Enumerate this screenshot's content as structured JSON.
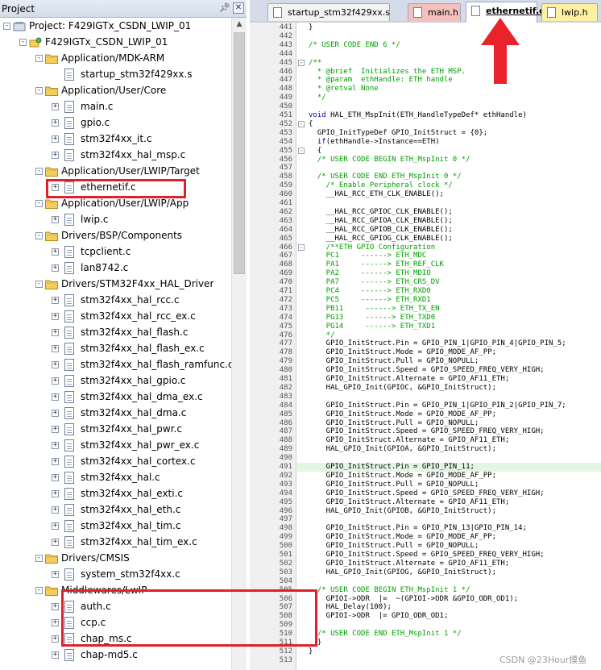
{
  "project_panel": {
    "title": "Project",
    "pin_icon": "pin-icon",
    "close_icon": "close-icon",
    "tree": [
      {
        "label": "Project: F429IGTx_CSDN_LWIP_01",
        "type": "project",
        "toggle": "-"
      },
      {
        "label": "F429IGTx_CSDN_LWIP_01",
        "type": "target",
        "toggle": "-"
      },
      {
        "label": "Application/MDK-ARM",
        "type": "folder",
        "toggle": "-"
      },
      {
        "label": "startup_stm32f429xx.s",
        "type": "file",
        "toggle": ""
      },
      {
        "label": "Application/User/Core",
        "type": "folder",
        "toggle": "-"
      },
      {
        "label": "main.c",
        "type": "file",
        "toggle": "+"
      },
      {
        "label": "gpio.c",
        "type": "file",
        "toggle": "+"
      },
      {
        "label": "stm32f4xx_it.c",
        "type": "file",
        "toggle": "+"
      },
      {
        "label": "stm32f4xx_hal_msp.c",
        "type": "file",
        "toggle": "+"
      },
      {
        "label": "Application/User/LWIP/Target",
        "type": "folder",
        "toggle": "-"
      },
      {
        "label": "ethernetif.c",
        "type": "file",
        "toggle": "+"
      },
      {
        "label": "Application/User/LWIP/App",
        "type": "folder",
        "toggle": "-"
      },
      {
        "label": "lwip.c",
        "type": "file",
        "toggle": "+"
      },
      {
        "label": "Drivers/BSP/Components",
        "type": "folder",
        "toggle": "-"
      },
      {
        "label": "tcpclient.c",
        "type": "file",
        "toggle": "+"
      },
      {
        "label": "lan8742.c",
        "type": "file",
        "toggle": "+"
      },
      {
        "label": "Drivers/STM32F4xx_HAL_Driver",
        "type": "folder",
        "toggle": "-"
      },
      {
        "label": "stm32f4xx_hal_rcc.c",
        "type": "file",
        "toggle": "+"
      },
      {
        "label": "stm32f4xx_hal_rcc_ex.c",
        "type": "file",
        "toggle": "+"
      },
      {
        "label": "stm32f4xx_hal_flash.c",
        "type": "file",
        "toggle": "+"
      },
      {
        "label": "stm32f4xx_hal_flash_ex.c",
        "type": "file",
        "toggle": "+"
      },
      {
        "label": "stm32f4xx_hal_flash_ramfunc.c",
        "type": "file",
        "toggle": "+"
      },
      {
        "label": "stm32f4xx_hal_gpio.c",
        "type": "file",
        "toggle": "+"
      },
      {
        "label": "stm32f4xx_hal_dma_ex.c",
        "type": "file",
        "toggle": "+"
      },
      {
        "label": "stm32f4xx_hal_dma.c",
        "type": "file",
        "toggle": "+"
      },
      {
        "label": "stm32f4xx_hal_pwr.c",
        "type": "file",
        "toggle": "+"
      },
      {
        "label": "stm32f4xx_hal_pwr_ex.c",
        "type": "file",
        "toggle": "+"
      },
      {
        "label": "stm32f4xx_hal_cortex.c",
        "type": "file",
        "toggle": "+"
      },
      {
        "label": "stm32f4xx_hal.c",
        "type": "file",
        "toggle": "+"
      },
      {
        "label": "stm32f4xx_hal_exti.c",
        "type": "file",
        "toggle": "+"
      },
      {
        "label": "stm32f4xx_hal_eth.c",
        "type": "file",
        "toggle": "+"
      },
      {
        "label": "stm32f4xx_hal_tim.c",
        "type": "file",
        "toggle": "+"
      },
      {
        "label": "stm32f4xx_hal_tim_ex.c",
        "type": "file",
        "toggle": "+"
      },
      {
        "label": "Drivers/CMSIS",
        "type": "folder",
        "toggle": "-"
      },
      {
        "label": "system_stm32f4xx.c",
        "type": "file",
        "toggle": "+"
      },
      {
        "label": "Middlewares/LwIP",
        "type": "folder",
        "toggle": "-"
      },
      {
        "label": "auth.c",
        "type": "file",
        "toggle": "+"
      },
      {
        "label": "ccp.c",
        "type": "file",
        "toggle": "+"
      },
      {
        "label": "chap_ms.c",
        "type": "file",
        "toggle": "+"
      },
      {
        "label": "chap-md5.c",
        "type": "file",
        "toggle": "+"
      }
    ]
  },
  "editor": {
    "tabs": [
      {
        "label": "startup_stm32f429xx.s",
        "active": false,
        "color": "#f3f3f3"
      },
      {
        "label": "main.h",
        "active": false,
        "color": "#f4c0bd"
      },
      {
        "label": "ethernetif.c",
        "active": true,
        "color": "#ffffff"
      },
      {
        "label": "lwip.h",
        "active": false,
        "color": "#fdf0a4"
      }
    ],
    "lines": [
      {
        "n": "441",
        "t": "}",
        "c": "code"
      },
      {
        "n": "442",
        "t": "",
        "c": "code"
      },
      {
        "n": "443",
        "t": "/* USER CODE END 6 */",
        "c": "comment"
      },
      {
        "n": "444",
        "t": "",
        "c": "code"
      },
      {
        "n": "445",
        "t": "/**",
        "c": "comment",
        "fold": "-"
      },
      {
        "n": "446",
        "t": "  * @brief  Initializes the ETH MSP.",
        "c": "comment"
      },
      {
        "n": "447",
        "t": "  * @param  ethHandle: ETH handle",
        "c": "comment"
      },
      {
        "n": "448",
        "t": "  * @retval None",
        "c": "comment"
      },
      {
        "n": "449",
        "t": "  */",
        "c": "comment"
      },
      {
        "n": "450",
        "t": "",
        "c": "code"
      },
      {
        "n": "451",
        "t": "void HAL_ETH_MspInit(ETH_HandleTypeDef* ethHandle)",
        "c": "code"
      },
      {
        "n": "452",
        "t": "{",
        "c": "code",
        "fold": "-"
      },
      {
        "n": "453",
        "t": "  GPIO_InitTypeDef GPIO_InitStruct = {0};",
        "c": "code"
      },
      {
        "n": "454",
        "t": "  if(ethHandle->Instance==ETH)",
        "c": "code"
      },
      {
        "n": "455",
        "t": "  {",
        "c": "code",
        "fold": "-"
      },
      {
        "n": "456",
        "t": "  /* USER CODE BEGIN ETH_MspInit 0 */",
        "c": "comment"
      },
      {
        "n": "457",
        "t": "",
        "c": "code"
      },
      {
        "n": "458",
        "t": "  /* USER CODE END ETH_MspInit 0 */",
        "c": "comment"
      },
      {
        "n": "459",
        "t": "    /* Enable Peripheral clock */",
        "c": "comment"
      },
      {
        "n": "460",
        "t": "    __HAL_RCC_ETH_CLK_ENABLE();",
        "c": "code"
      },
      {
        "n": "461",
        "t": "",
        "c": "code"
      },
      {
        "n": "462",
        "t": "    __HAL_RCC_GPIOC_CLK_ENABLE();",
        "c": "code"
      },
      {
        "n": "463",
        "t": "    __HAL_RCC_GPIOA_CLK_ENABLE();",
        "c": "code"
      },
      {
        "n": "464",
        "t": "    __HAL_RCC_GPIOB_CLK_ENABLE();",
        "c": "code"
      },
      {
        "n": "465",
        "t": "    __HAL_RCC_GPIOG_CLK_ENABLE();",
        "c": "code"
      },
      {
        "n": "466",
        "t": "    /**ETH GPIO Configuration",
        "c": "comment",
        "fold": "-"
      },
      {
        "n": "467",
        "t": "    PC1     ------> ETH_MDC",
        "c": "comment"
      },
      {
        "n": "468",
        "t": "    PA1     ------> ETH_REF_CLK",
        "c": "comment"
      },
      {
        "n": "469",
        "t": "    PA2     ------> ETH_MDIO",
        "c": "comment"
      },
      {
        "n": "470",
        "t": "    PA7     ------> ETH_CRS_DV",
        "c": "comment"
      },
      {
        "n": "471",
        "t": "    PC4     ------> ETH_RXD0",
        "c": "comment"
      },
      {
        "n": "472",
        "t": "    PC5     ------> ETH_RXD1",
        "c": "comment"
      },
      {
        "n": "473",
        "t": "    PB11     ------> ETH_TX_EN",
        "c": "comment"
      },
      {
        "n": "474",
        "t": "    PG13     ------> ETH_TXD0",
        "c": "comment"
      },
      {
        "n": "475",
        "t": "    PG14     ------> ETH_TXD1",
        "c": "comment"
      },
      {
        "n": "476",
        "t": "    */",
        "c": "comment"
      },
      {
        "n": "477",
        "t": "    GPIO_InitStruct.Pin = GPIO_PIN_1|GPIO_PIN_4|GPIO_PIN_5;",
        "c": "code"
      },
      {
        "n": "478",
        "t": "    GPIO_InitStruct.Mode = GPIO_MODE_AF_PP;",
        "c": "code"
      },
      {
        "n": "479",
        "t": "    GPIO_InitStruct.Pull = GPIO_NOPULL;",
        "c": "code"
      },
      {
        "n": "480",
        "t": "    GPIO_InitStruct.Speed = GPIO_SPEED_FREQ_VERY_HIGH;",
        "c": "code"
      },
      {
        "n": "481",
        "t": "    GPIO_InitStruct.Alternate = GPIO_AF11_ETH;",
        "c": "code"
      },
      {
        "n": "482",
        "t": "    HAL_GPIO_Init(GPIOC, &GPIO_InitStruct);",
        "c": "code"
      },
      {
        "n": "483",
        "t": "",
        "c": "code"
      },
      {
        "n": "484",
        "t": "    GPIO_InitStruct.Pin = GPIO_PIN_1|GPIO_PIN_2|GPIO_PIN_7;",
        "c": "code"
      },
      {
        "n": "485",
        "t": "    GPIO_InitStruct.Mode = GPIO_MODE_AF_PP;",
        "c": "code"
      },
      {
        "n": "486",
        "t": "    GPIO_InitStruct.Pull = GPIO_NOPULL;",
        "c": "code"
      },
      {
        "n": "487",
        "t": "    GPIO_InitStruct.Speed = GPIO_SPEED_FREQ_VERY_HIGH;",
        "c": "code"
      },
      {
        "n": "488",
        "t": "    GPIO_InitStruct.Alternate = GPIO_AF11_ETH;",
        "c": "code"
      },
      {
        "n": "489",
        "t": "    HAL_GPIO_Init(GPIOA, &GPIO_InitStruct);",
        "c": "code"
      },
      {
        "n": "490",
        "t": "",
        "c": "code"
      },
      {
        "n": "491",
        "t": "    GPIO_InitStruct.Pin = GPIO_PIN_11;",
        "c": "code",
        "current": true
      },
      {
        "n": "492",
        "t": "    GPIO_InitStruct.Mode = GPIO_MODE_AF_PP;",
        "c": "code"
      },
      {
        "n": "493",
        "t": "    GPIO_InitStruct.Pull = GPIO_NOPULL;",
        "c": "code"
      },
      {
        "n": "494",
        "t": "    GPIO_InitStruct.Speed = GPIO_SPEED_FREQ_VERY_HIGH;",
        "c": "code"
      },
      {
        "n": "495",
        "t": "    GPIO_InitStruct.Alternate = GPIO_AF11_ETH;",
        "c": "code"
      },
      {
        "n": "496",
        "t": "    HAL_GPIO_Init(GPIOB, &GPIO_InitStruct);",
        "c": "code"
      },
      {
        "n": "497",
        "t": "",
        "c": "code"
      },
      {
        "n": "498",
        "t": "    GPIO_InitStruct.Pin = GPIO_PIN_13|GPIO_PIN_14;",
        "c": "code"
      },
      {
        "n": "499",
        "t": "    GPIO_InitStruct.Mode = GPIO_MODE_AF_PP;",
        "c": "code"
      },
      {
        "n": "500",
        "t": "    GPIO_InitStruct.Pull = GPIO_NOPULL;",
        "c": "code"
      },
      {
        "n": "501",
        "t": "    GPIO_InitStruct.Speed = GPIO_SPEED_FREQ_VERY_HIGH;",
        "c": "code"
      },
      {
        "n": "502",
        "t": "    GPIO_InitStruct.Alternate = GPIO_AF11_ETH;",
        "c": "code"
      },
      {
        "n": "503",
        "t": "    HAL_GPIO_Init(GPIOG, &GPIO_InitStruct);",
        "c": "code"
      },
      {
        "n": "504",
        "t": "",
        "c": "code"
      },
      {
        "n": "505",
        "t": "  /* USER CODE BEGIN ETH_MspInit 1 */",
        "c": "comment"
      },
      {
        "n": "506",
        "t": "    GPIOI->ODR  |=  ~(GPIOI->ODR &GPIO_ODR_OD1);",
        "c": "code"
      },
      {
        "n": "507",
        "t": "    HAL_Delay(100);",
        "c": "code"
      },
      {
        "n": "508",
        "t": "    GPIOI->ODR  |= GPIO_ODR_OD1;",
        "c": "code"
      },
      {
        "n": "509",
        "t": "",
        "c": "code"
      },
      {
        "n": "510",
        "t": "  /* USER CODE END ETH_MspInit 1 */",
        "c": "comment"
      },
      {
        "n": "511",
        "t": "  }",
        "c": "code"
      },
      {
        "n": "512",
        "t": "}",
        "c": "code"
      },
      {
        "n": "513",
        "t": "",
        "c": "code"
      }
    ]
  },
  "annotations": {
    "highlight_color": "#e0202a",
    "watermark": "CSDN @23Hour摸鱼"
  }
}
